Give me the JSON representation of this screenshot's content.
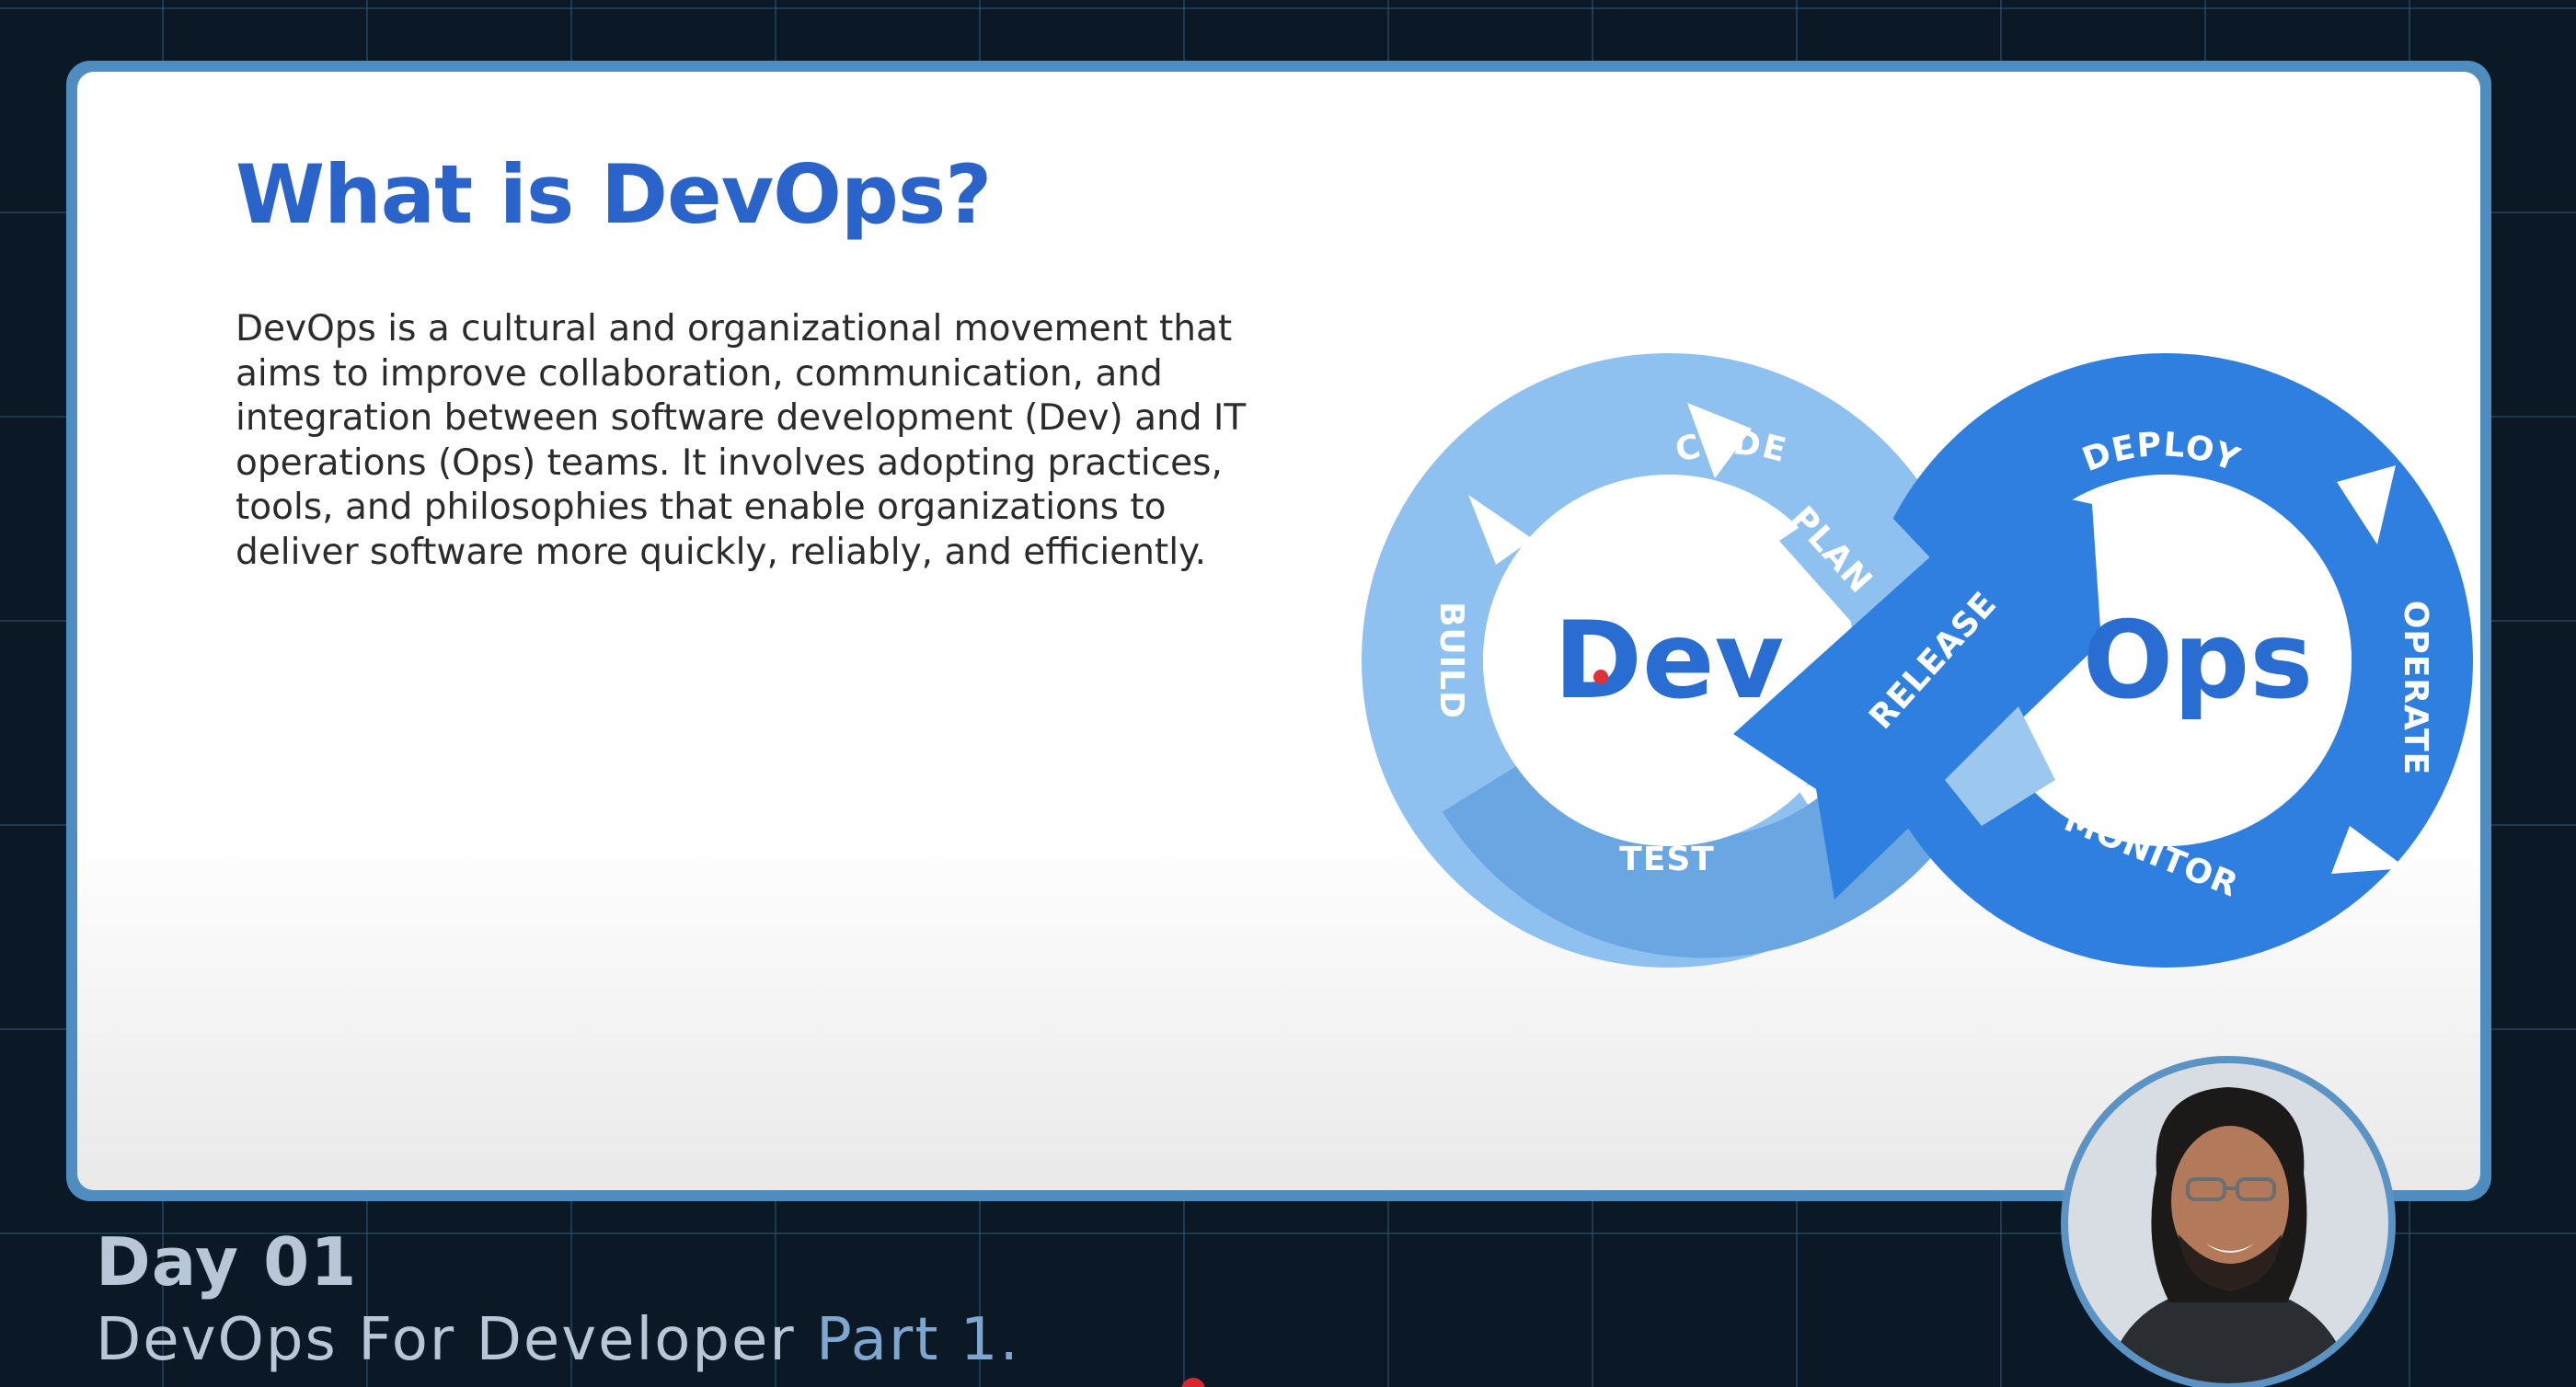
{
  "slide": {
    "title": "What is DevOps?",
    "body": "DevOps is a cultural and organizational movement that aims to improve collaboration, communication, and integration between software development (Dev) and IT operations (Ops) teams. It involves adopting practices, tools, and philosophies that enable organizations to deliver software more quickly, reliably, and efficiently."
  },
  "diagram": {
    "dev_label": "Dev",
    "ops_label": "Ops",
    "stages": {
      "code": "CODE",
      "plan": "PLAN",
      "build": "BUILD",
      "test": "TEST",
      "release": "RELEASE",
      "deploy": "DEPLOY",
      "operate": "OPERATE",
      "monitor": "MONITOR"
    },
    "colors": {
      "dev_light": "#8fc1f0",
      "dev_medium": "#6aa6e2",
      "ops_blue": "#2f7fe0",
      "label_blue": "#2a6dd2"
    }
  },
  "footer": {
    "day": "Day 01",
    "subtitle_main": "DevOps For Developer",
    "subtitle_accent": "Part 1."
  },
  "presenter": {
    "avatar_icon": "presenter-webcam-avatar"
  }
}
